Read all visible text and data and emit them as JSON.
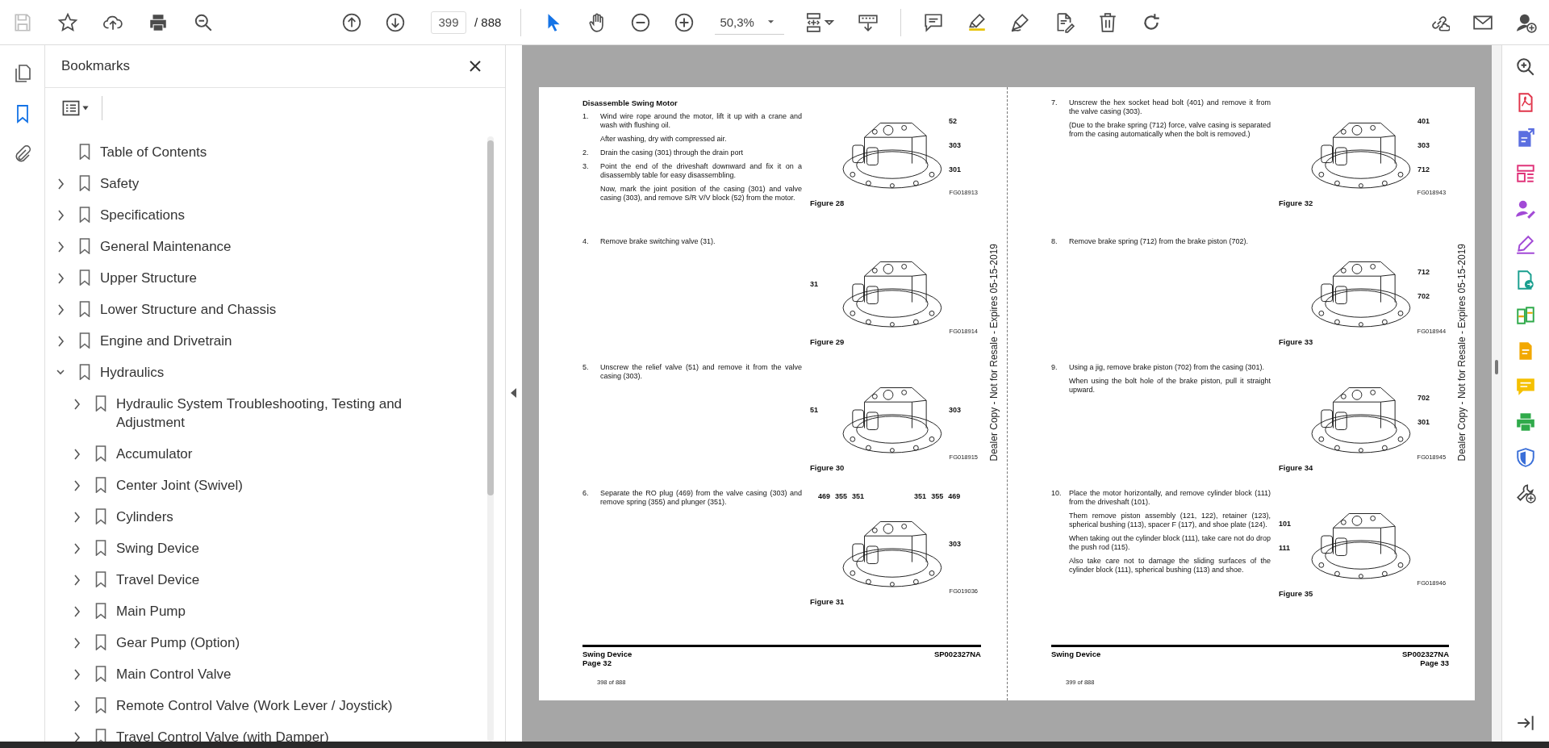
{
  "toolbar": {
    "save": {
      "disabled": true
    },
    "page_field": {
      "value": "399"
    },
    "page_total": "/ 888",
    "tools": [
      {
        "kind": "pointer",
        "selected": true
      },
      {
        "kind": "hand",
        "selected": false
      }
    ],
    "zoom_field": {
      "value": "50,3%"
    }
  },
  "sidebar": {
    "tabs": [
      {
        "kind": "pages",
        "selected": false
      },
      {
        "kind": "bookmarks",
        "selected": true
      },
      {
        "kind": "attachments",
        "selected": false
      }
    ]
  },
  "bookmarks": {
    "title": "Bookmarks",
    "items": [
      {
        "label": "Table of Contents",
        "kind": "leaf"
      },
      {
        "label": "Safety",
        "kind": "branch",
        "expanded": false
      },
      {
        "label": "Specifications",
        "kind": "branch",
        "expanded": false
      },
      {
        "label": "General Maintenance",
        "kind": "branch",
        "expanded": false
      },
      {
        "label": "Upper Structure",
        "kind": "branch",
        "expanded": false
      },
      {
        "label": "Lower Structure and Chassis",
        "kind": "branch",
        "expanded": false
      },
      {
        "label": "Engine and Drivetrain",
        "kind": "branch",
        "expanded": false
      },
      {
        "label": "Hydraulics",
        "kind": "branch",
        "expanded": true,
        "children": [
          {
            "label": "Hydraulic System Troubleshooting, Testing and Adjustment",
            "kind": "branch",
            "expanded": false
          },
          {
            "label": "Accumulator",
            "kind": "branch",
            "expanded": false
          },
          {
            "label": "Center Joint (Swivel)",
            "kind": "branch",
            "expanded": false
          },
          {
            "label": "Cylinders",
            "kind": "branch",
            "expanded": false
          },
          {
            "label": "Swing Device",
            "kind": "branch",
            "expanded": false
          },
          {
            "label": "Travel Device",
            "kind": "branch",
            "expanded": false
          },
          {
            "label": "Main Pump",
            "kind": "branch",
            "expanded": false
          },
          {
            "label": "Gear Pump (Option)",
            "kind": "branch",
            "expanded": false
          },
          {
            "label": "Main Control Valve",
            "kind": "branch",
            "expanded": false
          },
          {
            "label": "Remote Control Valve (Work Lever / Joystick)",
            "kind": "branch",
            "expanded": false
          },
          {
            "label": "Travel Control Valve (with Damper)",
            "kind": "branch",
            "expanded": false
          }
        ]
      }
    ]
  },
  "document": {
    "pages": [
      {
        "heading": "Disassemble Swing Motor",
        "stamp": "Dealer Copy - Not for Resale - Expires 05-15-2019",
        "sections": [
          {
            "steps": [
              {
                "number": "1.",
                "paragraphs": [
                  "Wind wire rope around the motor, lift it up with a crane and wash with flushing oil.",
                  "After washing, dry with compressed air."
                ]
              },
              {
                "number": "2.",
                "paragraphs": [
                  "Drain the casing (301) through the drain port"
                ]
              },
              {
                "number": "3.",
                "paragraphs": [
                  "Point the end of the driveshaft downward and fix it on a disassembly table for easy disassembling.",
                  "Now, mark the joint position of the casing (301) and valve casing (303), and remove S/R V/V block (52) from the motor."
                ]
              }
            ],
            "figure": {
              "code": "FG018913",
              "caption": "Figure 28",
              "right_callouts": [
                "52",
                "303",
                "301"
              ]
            }
          },
          {
            "steps": [
              {
                "number": "4.",
                "paragraphs": [
                  "Remove brake switching valve (31)."
                ]
              }
            ],
            "figure": {
              "code": "FG018914",
              "caption": "Figure 29",
              "left_callouts": [
                "31"
              ]
            }
          },
          {
            "steps": [
              {
                "number": "5.",
                "paragraphs": [
                  "Unscrew the relief valve (51) and remove it from the valve casing (303)."
                ]
              }
            ],
            "figure": {
              "code": "FG018915",
              "caption": "Figure 30",
              "left_callouts": [
                "51"
              ],
              "right_callouts": [
                "303"
              ]
            }
          },
          {
            "steps": [
              {
                "number": "6.",
                "paragraphs": [
                  "Separate the RO plug (469) from the valve casing (303) and remove spring (355) and plunger (351)."
                ]
              }
            ],
            "figure": {
              "code": "FG019036",
              "caption": "Figure 31",
              "top_callouts": [
                "469",
                "355",
                "351",
                "351",
                "355",
                "469"
              ],
              "right_callouts": [
                "303"
              ]
            }
          }
        ],
        "footer": {
          "left": [
            "Swing Device",
            "Page 32"
          ],
          "right": [
            "SP002327NA"
          ]
        },
        "page_label": "398 of 888"
      },
      {
        "stamp": "Dealer Copy - Not for Resale - Expires 05-15-2019",
        "sections": [
          {
            "steps": [
              {
                "number": "7.",
                "paragraphs": [
                  "Unscrew the hex socket head bolt (401) and remove it from the valve casing (303).",
                  "(Due to the brake spring (712) force, valve casing is separated from the casing automatically when the bolt is removed.)"
                ]
              }
            ],
            "figure": {
              "code": "FG018943",
              "caption": "Figure 32",
              "right_callouts": [
                "401",
                "303",
                "712"
              ]
            }
          },
          {
            "steps": [
              {
                "number": "8.",
                "paragraphs": [
                  "Remove brake spring (712) from the brake piston (702)."
                ]
              }
            ],
            "figure": {
              "code": "FG018944",
              "caption": "Figure 33",
              "right_callouts": [
                "712",
                "702"
              ]
            }
          },
          {
            "steps": [
              {
                "number": "9.",
                "paragraphs": [
                  "Using a jig, remove brake piston (702) from the casing (301).",
                  "When using the bolt hole of the brake piston, pull it straight upward."
                ]
              }
            ],
            "figure": {
              "code": "FG018945",
              "caption": "Figure 34",
              "right_callouts": [
                "702",
                "301"
              ]
            }
          },
          {
            "steps": [
              {
                "number": "10.",
                "paragraphs": [
                  "Place the motor horizontally, and remove cylinder block (111) from the driveshaft (101).",
                  "Them remove piston assembly (121, 122), retainer (123), spherical bushing (113), spacer F (117), and shoe plate (124).",
                  "When taking out the cylinder block (111), take care not do drop the push rod (115).",
                  "Also take care not to damage the sliding surfaces of the cylinder block (111), spherical bushing (113) and shoe."
                ]
              }
            ],
            "figure": {
              "code": "FG018946",
              "caption": "Figure 35",
              "left_callouts": [
                "101",
                "111"
              ]
            }
          }
        ],
        "footer": {
          "left": [
            "Swing Device"
          ],
          "right": [
            "SP002327NA",
            "Page 33"
          ]
        },
        "page_label": "399 of 888"
      }
    ]
  }
}
